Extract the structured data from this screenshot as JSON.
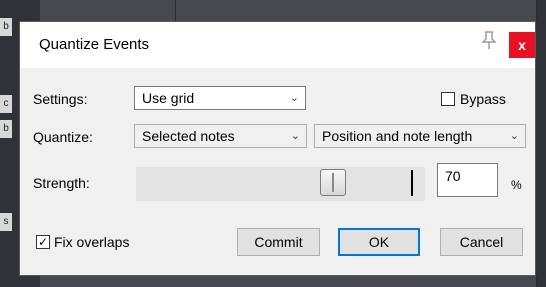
{
  "background": {
    "tab_letters": [
      "b",
      "c",
      "b",
      "s"
    ]
  },
  "dialog": {
    "title": "Quantize Events",
    "pin_icon": "pin-icon",
    "close_label": "x",
    "close_color": "#e81123"
  },
  "settings": {
    "label": "Settings:",
    "value": "Use grid"
  },
  "bypass": {
    "label": "Bypass",
    "checked": false
  },
  "quantize": {
    "label": "Quantize:",
    "selection_value": "Selected notes",
    "mode_value": "Position and note length"
  },
  "strength": {
    "label": "Strength:",
    "value": "70",
    "unit": "%",
    "level_percent": 70
  },
  "fix_overlaps": {
    "label": "Fix overlaps",
    "checked": true,
    "check_glyph": "✓"
  },
  "buttons": {
    "commit": "Commit",
    "ok": "OK",
    "cancel": "Cancel"
  },
  "accent_color": "#0078d7"
}
